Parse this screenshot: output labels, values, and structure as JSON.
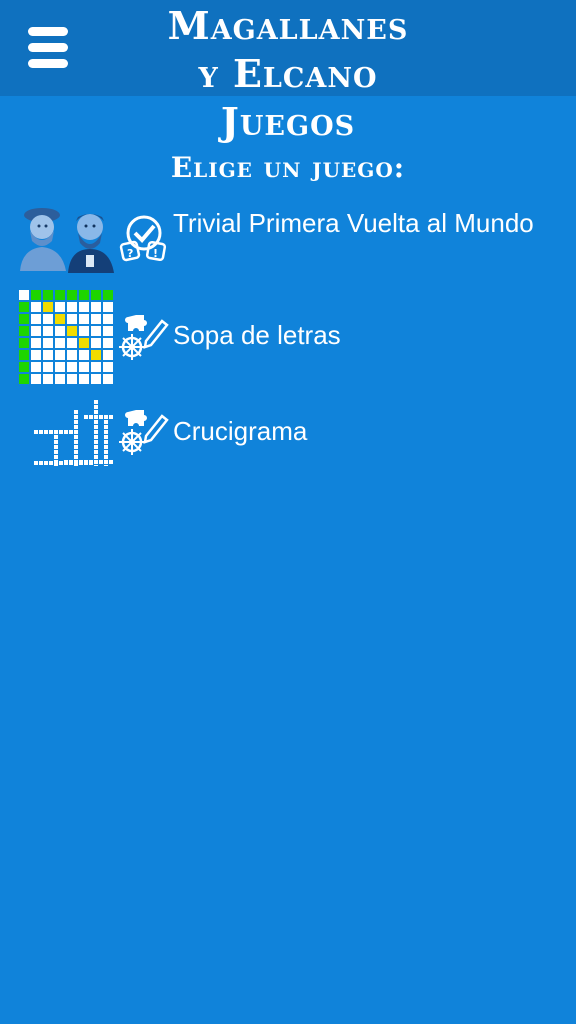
{
  "colors": {
    "background": "#1083da",
    "header": "#0f71bf",
    "grid_green": "#1ed400",
    "grid_yellow": "#f2dc00"
  },
  "header": {
    "menu_icon": "hamburger-menu-icon",
    "title_line1": "Magallanes",
    "title_line2": "y Elcano",
    "title_line3": "Juegos"
  },
  "subtitle": "Elige un juego:",
  "games": [
    {
      "label": "Trivial Primera Vuelta al Mundo",
      "thumb_icon": "explorers-portrait-icon",
      "tool_icon": "quiz-check-icon"
    },
    {
      "label": "Sopa de letras",
      "thumb_icon": "word-search-grid-icon",
      "tool_icon": "puzzle-helm-pencil-icon"
    },
    {
      "label": "Crucigrama",
      "thumb_icon": "crossword-grid-icon",
      "tool_icon": "puzzle-helm-pencil-icon"
    }
  ]
}
